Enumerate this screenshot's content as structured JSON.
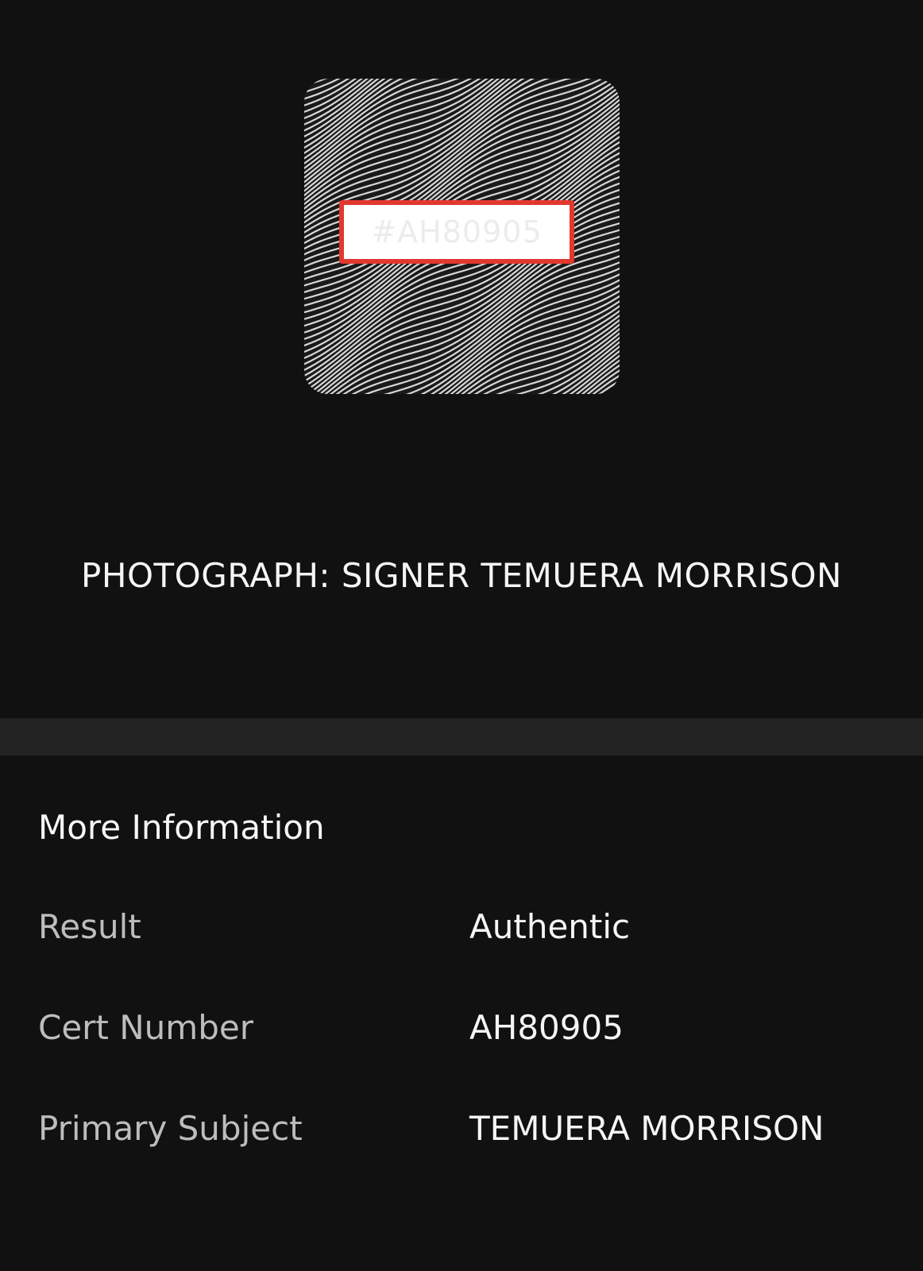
{
  "certificate": {
    "tag_text": "#AH80905",
    "tag_border_color": "#e2382f",
    "pattern": "wavy-line-security-pattern"
  },
  "item": {
    "title": "PHOTOGRAPH: SIGNER TEMUERA MORRISON"
  },
  "more_info": {
    "heading": "More Information",
    "rows": [
      {
        "label": "Result",
        "value": "Authentic"
      },
      {
        "label": "Cert Number",
        "value": "AH80905"
      },
      {
        "label": "Primary Subject",
        "value": "TEMUERA MORRISON"
      }
    ]
  },
  "colors": {
    "background": "#111111",
    "divider": "#222222",
    "label_text": "#bdbdbd",
    "value_text": "#f5f5f5"
  }
}
